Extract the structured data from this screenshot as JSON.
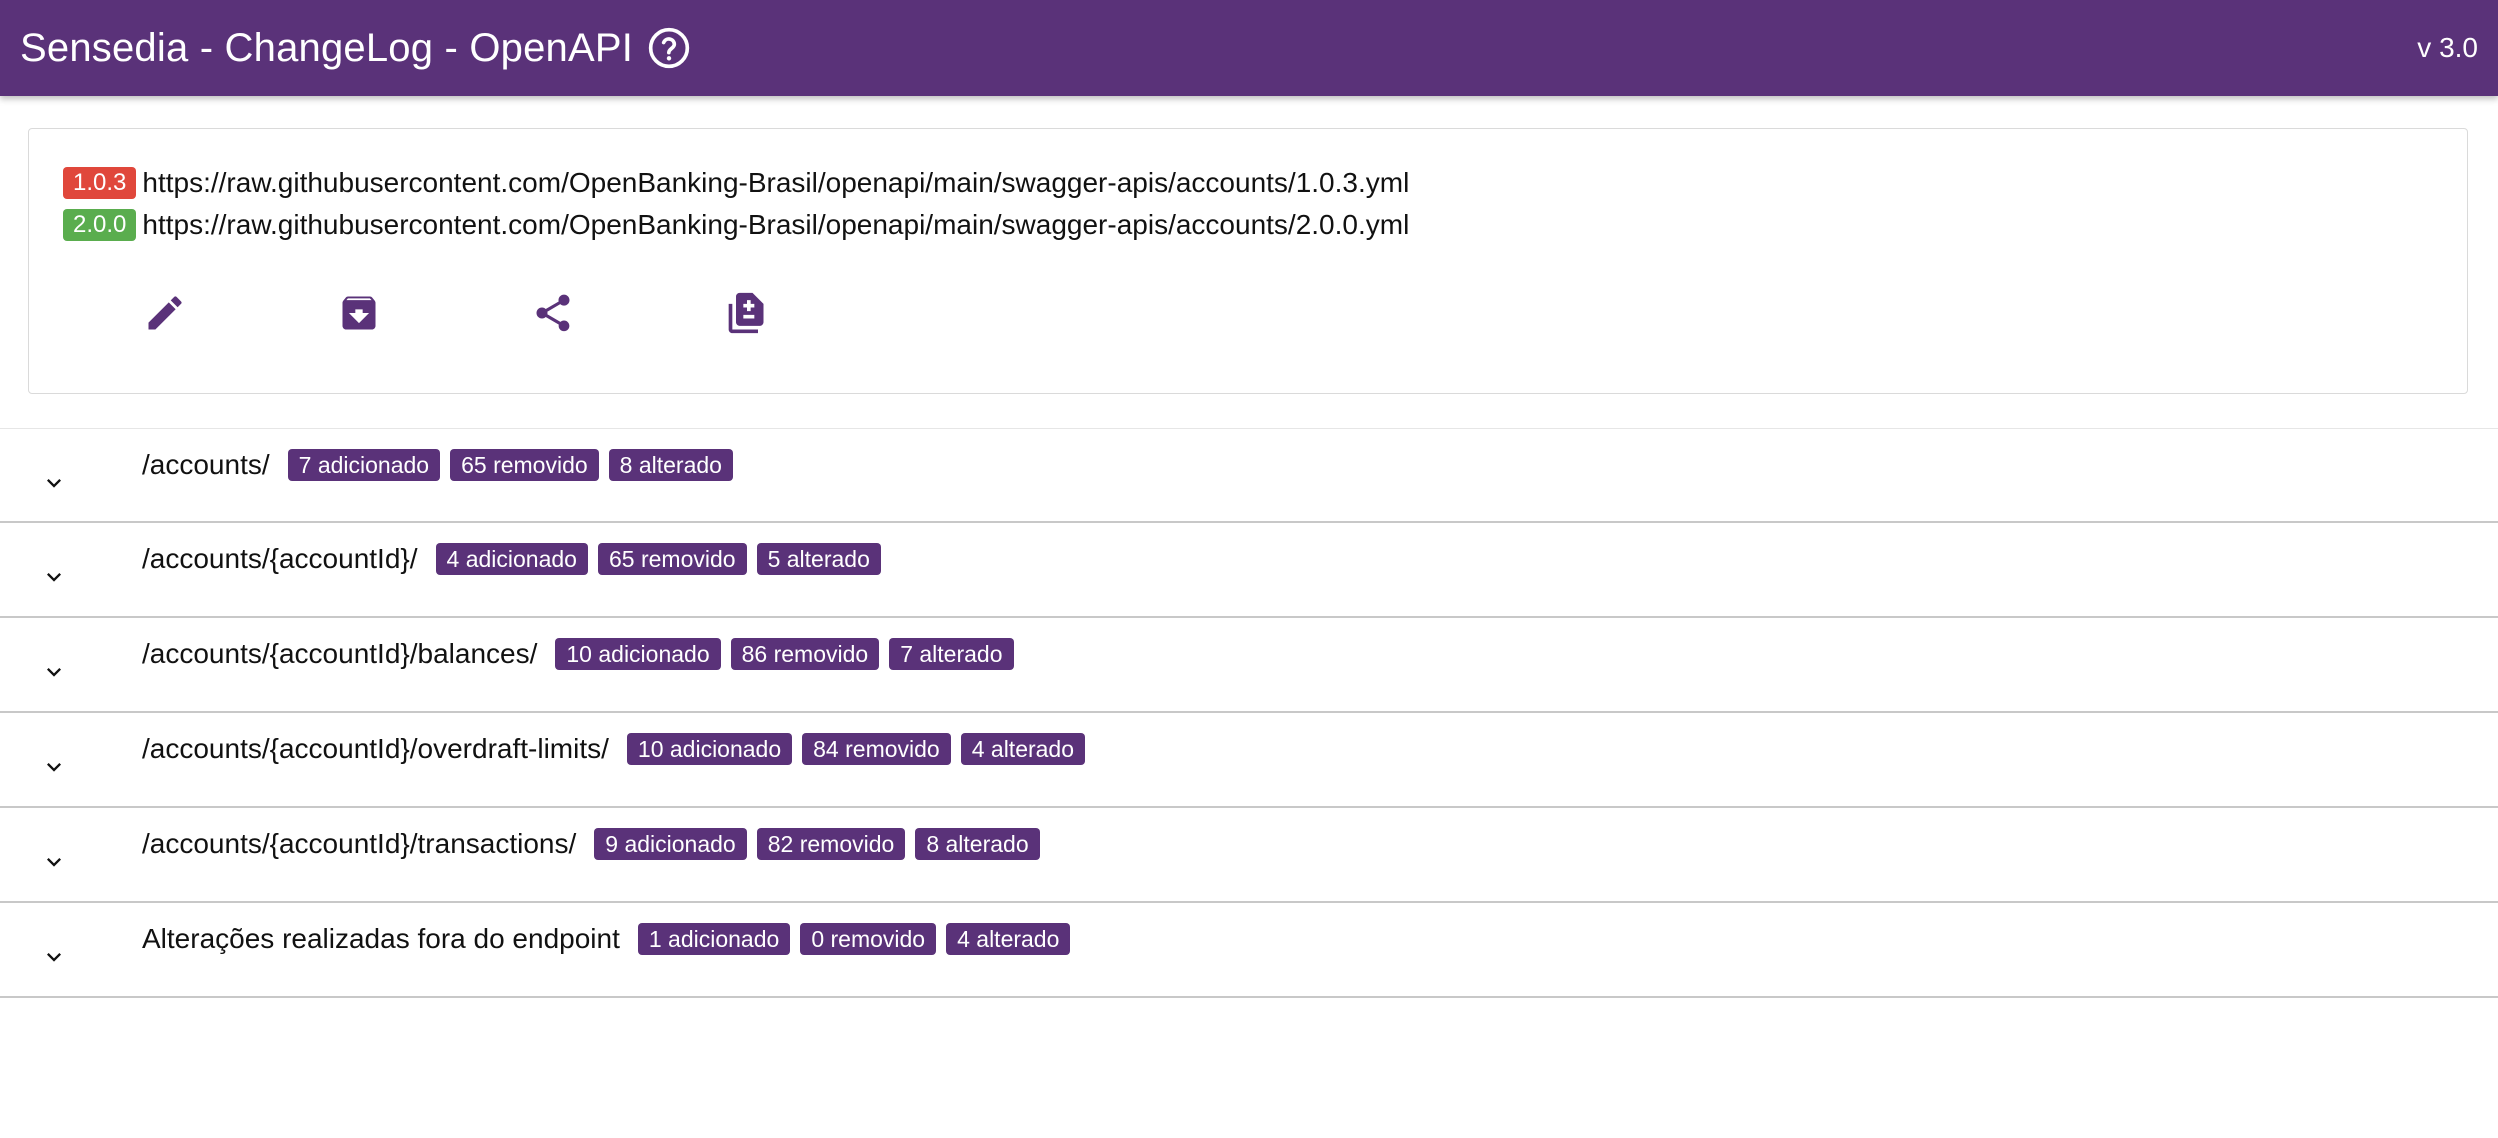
{
  "appbar": {
    "title": "Sensedia - ChangeLog - OpenAPI",
    "help_icon": "help-circle-icon",
    "version": "v 3.0",
    "color": "#5a3279"
  },
  "files": [
    {
      "version": "1.0.3",
      "badge_color": "#e0473b",
      "url": "https://raw.githubusercontent.com/OpenBanking-Brasil/openapi/main/swagger-apis/accounts/1.0.3.yml"
    },
    {
      "version": "2.0.0",
      "badge_color": "#5aad4e",
      "url": "https://raw.githubusercontent.com/OpenBanking-Brasil/openapi/main/swagger-apis/accounts/2.0.0.yml"
    }
  ],
  "actions": [
    {
      "icon": "pencil-edit-icon"
    },
    {
      "icon": "archive-download-icon"
    },
    {
      "icon": "share-icon"
    },
    {
      "icon": "copy-diff-icon"
    }
  ],
  "endpoints": [
    {
      "path": "/accounts/",
      "added": "7 adicionado",
      "removed": "65 removido",
      "changed": "8 alterado"
    },
    {
      "path": "/accounts/{accountId}/",
      "added": "4 adicionado",
      "removed": "65 removido",
      "changed": "5 alterado"
    },
    {
      "path": "/accounts/{accountId}/balances/",
      "added": "10 adicionado",
      "removed": "86 removido",
      "changed": "7 alterado"
    },
    {
      "path": "/accounts/{accountId}/overdraft-limits/",
      "added": "10 adicionado",
      "removed": "84 removido",
      "changed": "4 alterado"
    },
    {
      "path": "/accounts/{accountId}/transactions/",
      "added": "9 adicionado",
      "removed": "82 removido",
      "changed": "8 alterado"
    },
    {
      "path": "Alterações realizadas fora do endpoint",
      "added": "1 adicionado",
      "removed": "0 removido",
      "changed": "4 alterado"
    }
  ]
}
